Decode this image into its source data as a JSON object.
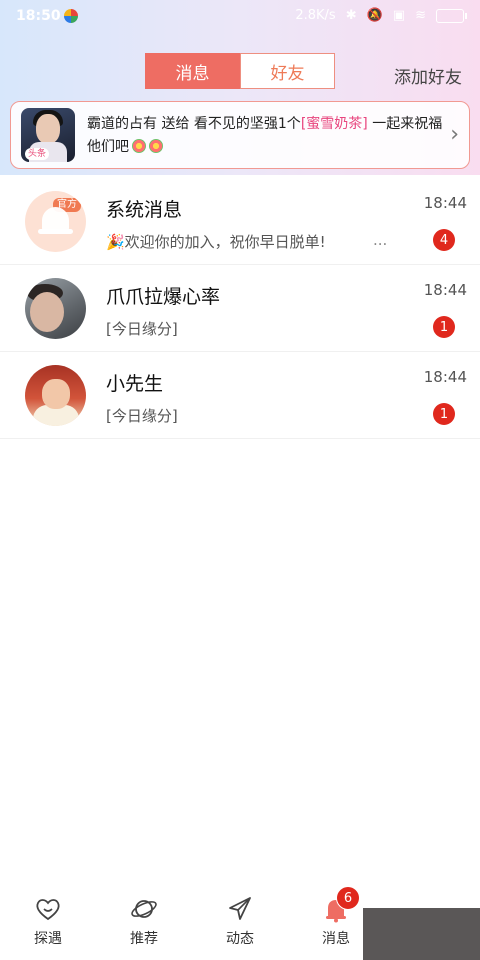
{
  "status_bar": {
    "time": "18:50",
    "speed": "2.8K/s"
  },
  "header": {
    "tabs": [
      {
        "label": "消息",
        "active": true
      },
      {
        "label": "好友",
        "active": false
      }
    ],
    "add_friend": "添加好友"
  },
  "banner": {
    "avatar_badge": "头条",
    "text_part1": "霸道的占有 送给 看不见的坚强1个",
    "highlight": "[蜜雪奶茶]",
    "text_part2": " 一起来祝福他们吧",
    "chevron": "›"
  },
  "messages": [
    {
      "name": "系统消息",
      "preview": "🎉欢迎你的加入，祝你早日脱单!",
      "ellipsis": "...",
      "time": "18:44",
      "unread": "4",
      "avatar_tag": "官方"
    },
    {
      "name": "爪爪拉爆心率",
      "preview": "[今日缘分]",
      "time": "18:44",
      "unread": "1"
    },
    {
      "name": "小先生",
      "preview": "[今日缘分]",
      "time": "18:44",
      "unread": "1"
    }
  ],
  "bottom_nav": {
    "items": [
      {
        "label": "探遇",
        "icon": "heart-face-icon"
      },
      {
        "label": "推荐",
        "icon": "planet-icon"
      },
      {
        "label": "动态",
        "icon": "paper-plane-icon"
      },
      {
        "label": "消息",
        "icon": "bell-icon"
      }
    ],
    "message_badge": "6"
  },
  "colors": {
    "accent": "#ee6d63",
    "highlight": "#e8457e",
    "badge": "#e0281d"
  }
}
